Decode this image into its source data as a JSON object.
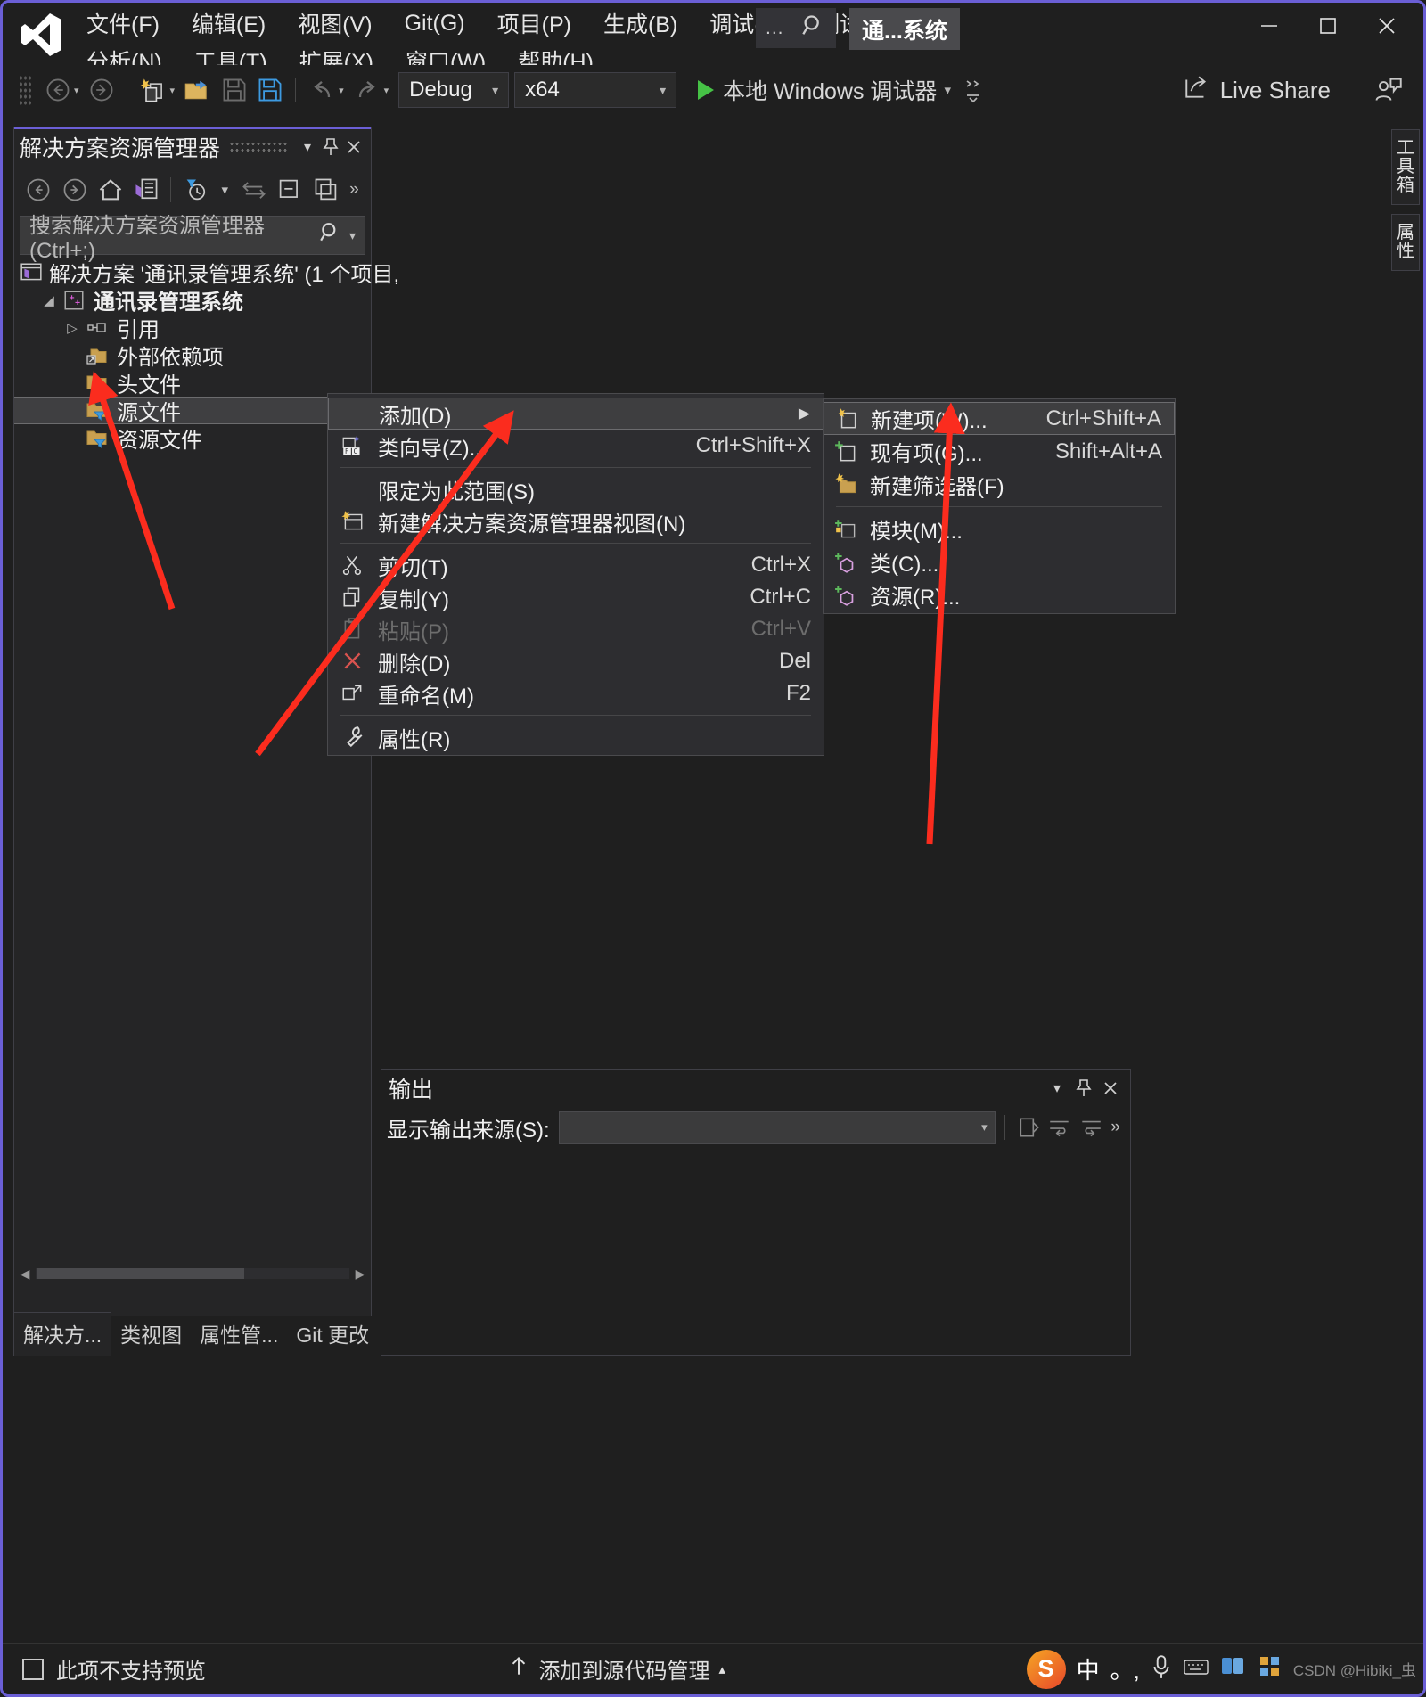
{
  "window": {
    "solution_badge": "通...系统",
    "minimize": "—",
    "maximize": "□",
    "close": "✕",
    "accent_color": "#6b5fd6"
  },
  "menubar": {
    "row1": [
      "文件(F)",
      "编辑(E)",
      "视图(V)",
      "Git(G)",
      "项目(P)",
      "生成(B)",
      "调试(D)",
      "测试(S)"
    ],
    "row2": [
      "分析(N)",
      "工具(T)",
      "扩展(X)",
      "窗口(W)",
      "帮助(H)"
    ],
    "search_dots": "..."
  },
  "toolbar": {
    "configuration": "Debug",
    "platform": "x64",
    "run_label": "本地 Windows 调试器",
    "live_share": "Live Share"
  },
  "solution_explorer": {
    "title": "解决方案资源管理器",
    "search_placeholder": "搜索解决方案资源管理器(Ctrl+;)",
    "tree": [
      {
        "label": "解决方案 '通讯录管理系统' (1 个项目,",
        "icon": "solution-icon",
        "indent": 0,
        "expander": "",
        "bold": false,
        "selected": false
      },
      {
        "label": "通讯录管理系统",
        "icon": "cpp-project-icon",
        "indent": 1,
        "expander": "▴",
        "bold": true,
        "selected": false
      },
      {
        "label": "引用",
        "icon": "references-icon",
        "indent": 2,
        "expander": "▸",
        "bold": false,
        "selected": false
      },
      {
        "label": "外部依赖项",
        "icon": "external-deps-icon",
        "indent": 2,
        "expander": "",
        "bold": false,
        "selected": false
      },
      {
        "label": "头文件",
        "icon": "filter-folder-icon",
        "indent": 2,
        "expander": "",
        "bold": false,
        "selected": false
      },
      {
        "label": "源文件",
        "icon": "filter-folder-icon",
        "indent": 2,
        "expander": "",
        "bold": false,
        "selected": true
      },
      {
        "label": "资源文件",
        "icon": "filter-folder-icon",
        "indent": 2,
        "expander": "",
        "bold": false,
        "selected": false
      }
    ],
    "tabs": [
      {
        "label": "解决方...",
        "active": true
      },
      {
        "label": "类视图",
        "active": false
      },
      {
        "label": "属性管...",
        "active": false
      },
      {
        "label": "Git 更改",
        "active": false
      }
    ]
  },
  "context_menu": {
    "items": [
      {
        "label": "添加(D)",
        "shortcut": "",
        "icon": "",
        "submenu": true,
        "highlighted": true,
        "disabled": false
      },
      {
        "label": "类向导(Z)...",
        "shortcut": "Ctrl+Shift+X",
        "icon": "class-wizard-icon",
        "submenu": false,
        "highlighted": false,
        "disabled": false
      },
      {
        "separator": true
      },
      {
        "label": "限定为此范围(S)",
        "shortcut": "",
        "icon": "",
        "submenu": false,
        "highlighted": false,
        "disabled": false
      },
      {
        "label": "新建解决方案资源管理器视图(N)",
        "shortcut": "",
        "icon": "new-se-view-icon",
        "submenu": false,
        "highlighted": false,
        "disabled": false
      },
      {
        "separator": true
      },
      {
        "label": "剪切(T)",
        "shortcut": "Ctrl+X",
        "icon": "scissors-icon",
        "submenu": false,
        "highlighted": false,
        "disabled": false
      },
      {
        "label": "复制(Y)",
        "shortcut": "Ctrl+C",
        "icon": "copy-icon",
        "submenu": false,
        "highlighted": false,
        "disabled": false
      },
      {
        "label": "粘贴(P)",
        "shortcut": "Ctrl+V",
        "icon": "paste-icon",
        "submenu": false,
        "highlighted": false,
        "disabled": true
      },
      {
        "label": "删除(D)",
        "shortcut": "Del",
        "icon": "delete-x-icon",
        "submenu": false,
        "highlighted": false,
        "disabled": false
      },
      {
        "label": "重命名(M)",
        "shortcut": "F2",
        "icon": "rename-icon",
        "submenu": false,
        "highlighted": false,
        "disabled": false
      },
      {
        "separator": true
      },
      {
        "label": "属性(R)",
        "shortcut": "",
        "icon": "wrench-icon",
        "submenu": false,
        "highlighted": false,
        "disabled": false
      }
    ]
  },
  "submenu": {
    "items": [
      {
        "label": "新建项(W)...",
        "shortcut": "Ctrl+Shift+A",
        "icon": "new-item-icon",
        "highlighted": true
      },
      {
        "label": "现有项(G)...",
        "shortcut": "Shift+Alt+A",
        "icon": "existing-item-icon",
        "highlighted": false
      },
      {
        "label": "新建筛选器(F)",
        "shortcut": "",
        "icon": "new-filter-icon",
        "highlighted": false
      },
      {
        "separator": true
      },
      {
        "label": "模块(M)...",
        "shortcut": "",
        "icon": "module-icon",
        "highlighted": false
      },
      {
        "label": "类(C)...",
        "shortcut": "",
        "icon": "class-icon",
        "highlighted": false
      },
      {
        "label": "资源(R)...",
        "shortcut": "",
        "icon": "resource-icon",
        "highlighted": false
      }
    ]
  },
  "output_pane": {
    "title": "输出",
    "source_label": "显示输出来源(S):",
    "source_value": ""
  },
  "right_dock": {
    "tabs": [
      "工具箱",
      "属性"
    ]
  },
  "status_bar": {
    "preview_text": "此项不支持预览",
    "source_control_text": "添加到源代码管理",
    "ime_text": "中",
    "ime_punct": "。,",
    "watermark": "CSDN @Hibiki_虫"
  }
}
